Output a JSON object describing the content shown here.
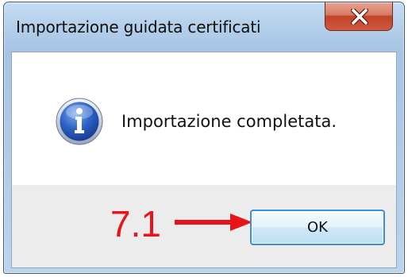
{
  "window": {
    "title": "Importazione guidata certificati",
    "close_icon": "close-icon"
  },
  "content": {
    "icon": "info-icon",
    "message": "Importazione completata."
  },
  "buttons": {
    "ok_label": "OK"
  },
  "annotation": {
    "label": "7.1",
    "color": "#e8141b",
    "arrow_icon": "arrow-right-icon"
  },
  "colors": {
    "title_bar": "#b4cfea",
    "close_button": "#c0432a",
    "button_bar": "#ececec",
    "ok_button_border": "#3d8fd0"
  }
}
